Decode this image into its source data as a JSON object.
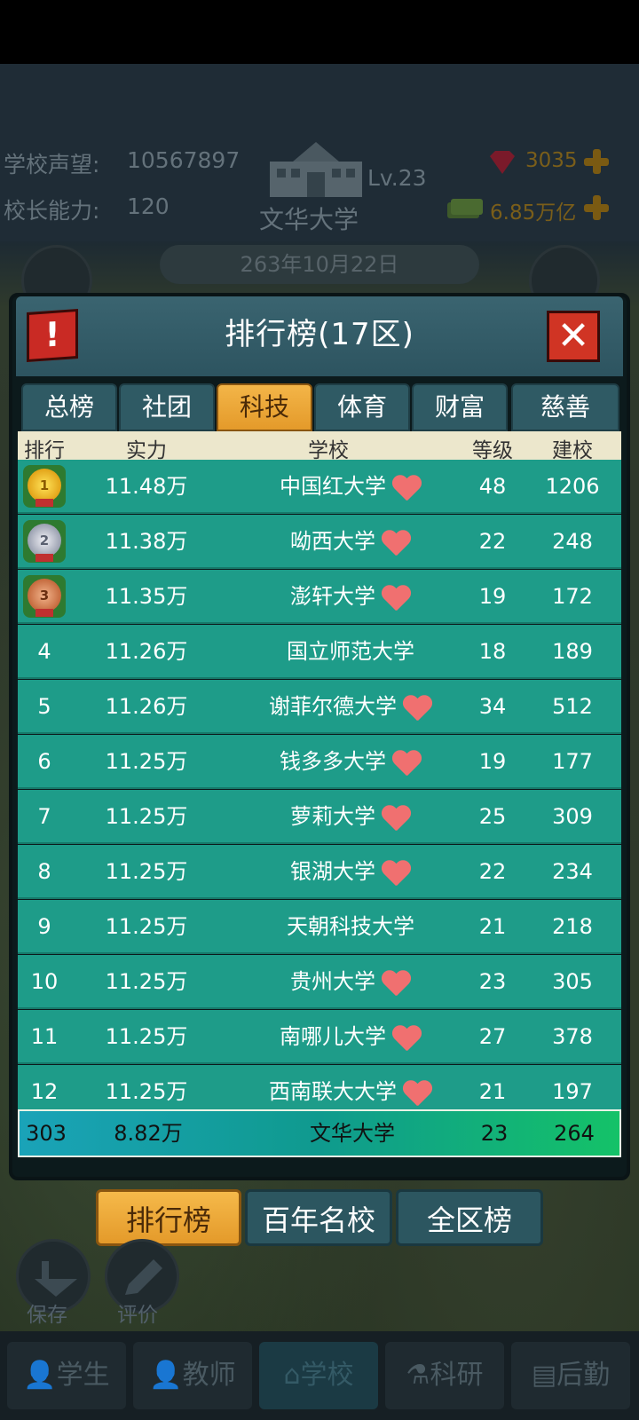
{
  "hud": {
    "reputation_label": "学校声望:",
    "reputation_value": "10567897",
    "ability_label": "校长能力:",
    "ability_value": "120",
    "level": "Lv.23",
    "school_name": "文华大学",
    "gems": "3035",
    "money": "6.85万亿",
    "date": "263年10月22日"
  },
  "panel": {
    "title": "排行榜(17区)",
    "alert": "!",
    "close": "✕"
  },
  "tabs": [
    "总榜",
    "社团",
    "科技",
    "体育",
    "财富",
    "慈善"
  ],
  "active_tab": "科技",
  "columns": {
    "rank": "排行",
    "power": "实力",
    "school": "学校",
    "level": "等级",
    "founded": "建校"
  },
  "rows": [
    {
      "rank": "1",
      "power": "11.48万",
      "school": "中国红大学",
      "level": "48",
      "founded": "1206",
      "heart": true
    },
    {
      "rank": "2",
      "power": "11.38万",
      "school": "呦西大学",
      "level": "22",
      "founded": "248",
      "heart": true
    },
    {
      "rank": "3",
      "power": "11.35万",
      "school": "澎轩大学",
      "level": "19",
      "founded": "172",
      "heart": true
    },
    {
      "rank": "4",
      "power": "11.26万",
      "school": "国立师范大学",
      "level": "18",
      "founded": "189",
      "heart": false
    },
    {
      "rank": "5",
      "power": "11.26万",
      "school": "谢菲尔德大学",
      "level": "34",
      "founded": "512",
      "heart": true
    },
    {
      "rank": "6",
      "power": "11.25万",
      "school": "钱多多大学",
      "level": "19",
      "founded": "177",
      "heart": true
    },
    {
      "rank": "7",
      "power": "11.25万",
      "school": "萝莉大学",
      "level": "25",
      "founded": "309",
      "heart": true
    },
    {
      "rank": "8",
      "power": "11.25万",
      "school": "银湖大学",
      "level": "22",
      "founded": "234",
      "heart": true
    },
    {
      "rank": "9",
      "power": "11.25万",
      "school": "天朝科技大学",
      "level": "21",
      "founded": "218",
      "heart": false
    },
    {
      "rank": "10",
      "power": "11.25万",
      "school": "贵州大学",
      "level": "23",
      "founded": "305",
      "heart": true
    },
    {
      "rank": "11",
      "power": "11.25万",
      "school": "南哪儿大学",
      "level": "27",
      "founded": "378",
      "heart": true
    },
    {
      "rank": "12",
      "power": "11.25万",
      "school": "西南联大大学",
      "level": "21",
      "founded": "197",
      "heart": true
    }
  ],
  "my_row": {
    "rank": "303",
    "power": "8.82万",
    "school": "文华大学",
    "level": "23",
    "founded": "264"
  },
  "bottom_tabs": [
    "排行榜",
    "百年名校",
    "全区榜"
  ],
  "side_buttons": {
    "save": "保存",
    "review": "评价"
  },
  "nav": [
    "学生",
    "教师",
    "学校",
    "科研",
    "后勤"
  ],
  "active_nav": "学校"
}
